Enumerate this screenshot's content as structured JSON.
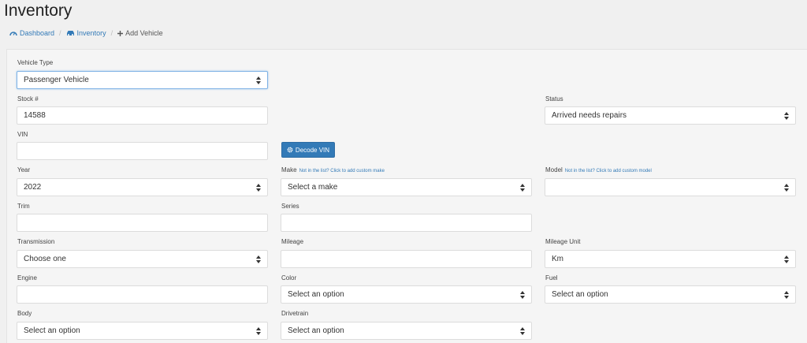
{
  "page": {
    "title": "Inventory"
  },
  "breadcrumb": [
    {
      "label": "Dashboard",
      "icon": "dashboard-icon"
    },
    {
      "label": "Inventory",
      "icon": "car-icon"
    },
    {
      "label": "Add Vehicle",
      "icon": "plus-icon"
    }
  ],
  "colors": {
    "link": "#337ab7",
    "button": "#337ab7",
    "background": "#f0f0f0"
  },
  "form": {
    "vehicle_type": {
      "label": "Vehicle Type",
      "value": "Passenger Vehicle"
    },
    "stock": {
      "label": "Stock #",
      "value": "14588"
    },
    "status": {
      "label": "Status",
      "value": "Arrived needs repairs"
    },
    "vin": {
      "label": "VIN",
      "value": ""
    },
    "decode_button": {
      "label": "Decode VIN"
    },
    "year": {
      "label": "Year",
      "value": "2022"
    },
    "make": {
      "label": "Make",
      "link": "Not in the list? Click to add custom make",
      "value": "Select a make"
    },
    "model": {
      "label": "Model",
      "link": "Not in the list? Click to add custom model",
      "value": ""
    },
    "trim": {
      "label": "Trim",
      "value": ""
    },
    "series": {
      "label": "Series",
      "value": ""
    },
    "transmission": {
      "label": "Transmission",
      "value": "Choose one"
    },
    "mileage": {
      "label": "Mileage",
      "value": ""
    },
    "mileage_unit": {
      "label": "Mileage Unit",
      "value": "Km"
    },
    "engine": {
      "label": "Engine",
      "value": ""
    },
    "color": {
      "label": "Color",
      "value": "Select an option"
    },
    "fuel": {
      "label": "Fuel",
      "value": "Select an option"
    },
    "body": {
      "label": "Body",
      "value": "Select an option"
    },
    "drivetrain": {
      "label": "Drivetrain",
      "value": "Select an option"
    }
  }
}
